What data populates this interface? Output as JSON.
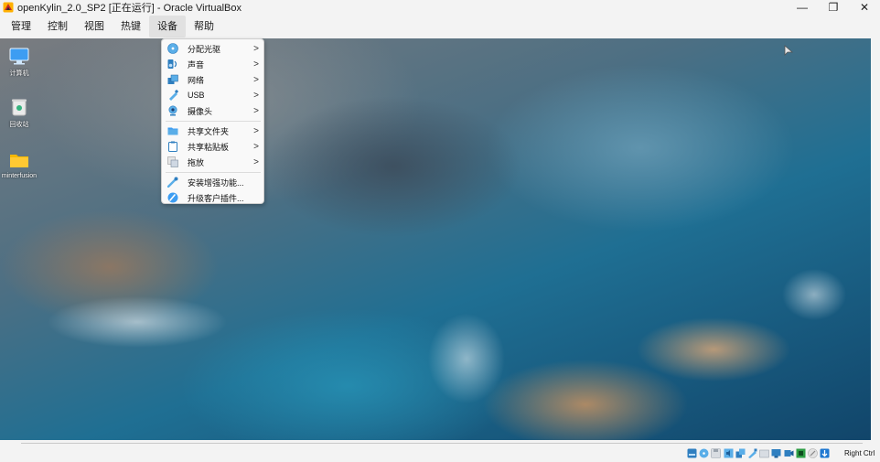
{
  "window": {
    "title": "openKylin_2.0_SP2 [正在运行] - Oracle VirtualBox",
    "minimize_glyph": "—",
    "restore_glyph": "❐",
    "close_glyph": "✕"
  },
  "menubar": {
    "items": [
      {
        "label": "管理"
      },
      {
        "label": "控制"
      },
      {
        "label": "视图"
      },
      {
        "label": "热键"
      },
      {
        "label": "设备"
      },
      {
        "label": "帮助"
      }
    ],
    "active_item": "设备"
  },
  "devices_menu": {
    "items": [
      {
        "label": "分配光驱",
        "icon": "optical-disc-icon",
        "submenu": true
      },
      {
        "label": "声音",
        "icon": "audio-icon",
        "submenu": true
      },
      {
        "label": "网络",
        "icon": "network-icon",
        "submenu": true
      },
      {
        "label": "USB",
        "icon": "usb-icon",
        "submenu": true
      },
      {
        "label": "摄像头",
        "icon": "webcam-icon",
        "submenu": true
      },
      {
        "label": "共享文件夹",
        "icon": "shared-folder-icon",
        "submenu": true
      },
      {
        "label": "共享粘贴板",
        "icon": "clipboard-icon",
        "submenu": true
      },
      {
        "label": "拖放",
        "icon": "drag-drop-icon",
        "submenu": true
      },
      {
        "label": "安装增强功能...",
        "icon": "guest-additions-icon",
        "submenu": false
      },
      {
        "label": "升级客户插件...",
        "icon": "upgrade-additions-icon",
        "submenu": false
      }
    ],
    "submenu_glyph": ">"
  },
  "desktop": {
    "icons": [
      {
        "label": "计算机",
        "icon": "computer-icon"
      },
      {
        "label": "回收站",
        "icon": "trash-icon"
      },
      {
        "label": "minterfusion",
        "icon": "folder-icon"
      }
    ]
  },
  "statusbar": {
    "host_key_label": "Right Ctrl",
    "indicators": [
      "hard-disk-icon",
      "optical-disc-icon",
      "floppy-icon",
      "audio-icon",
      "network-icon",
      "usb-icon",
      "shared-folder-icon",
      "display-icon",
      "recording-icon",
      "cpu-icon",
      "mouse-integration-icon",
      "arrow-down-icon"
    ]
  },
  "colors": {
    "chrome_bg": "#f3f3f3",
    "menu_bg": "#f9f9f9",
    "accent_blue": "#1f78d1"
  }
}
